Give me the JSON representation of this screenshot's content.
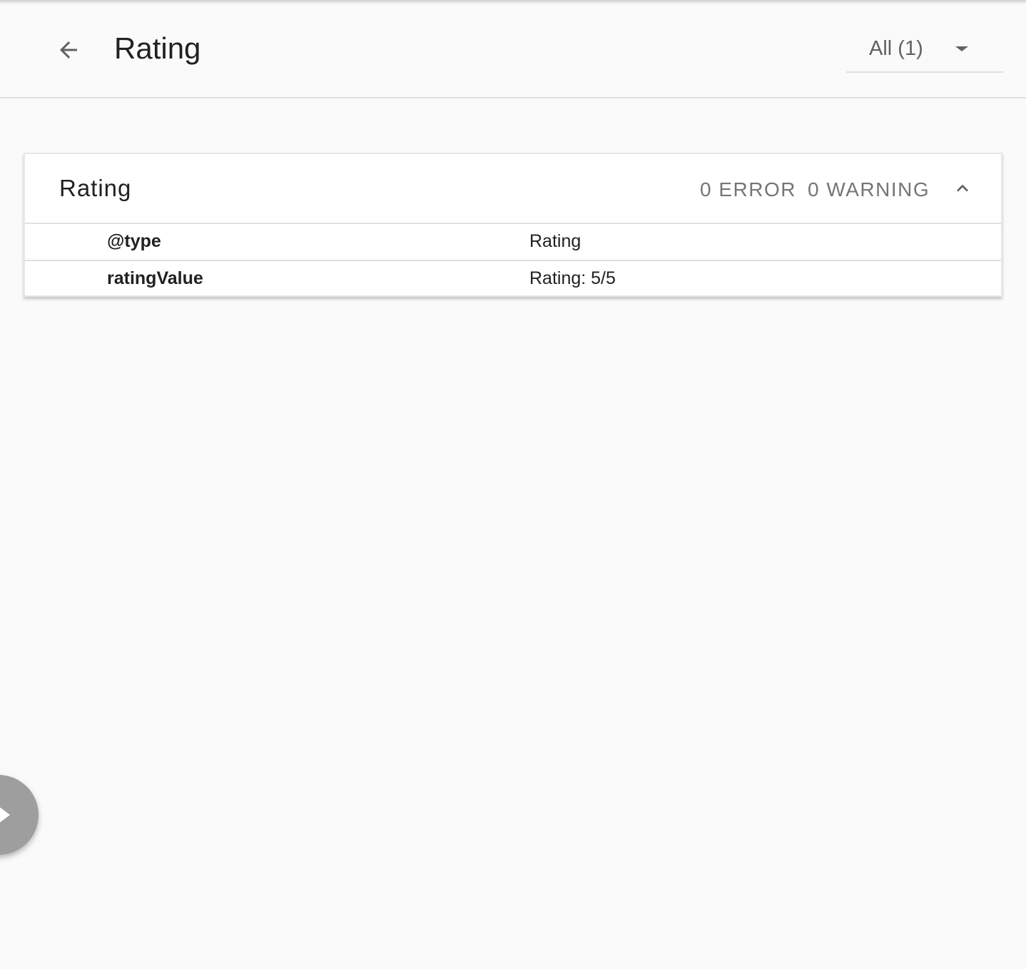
{
  "header": {
    "title": "Rating",
    "back_icon": "arrow-back-icon",
    "filter": {
      "selected": "All (1)",
      "icon": "dropdown-caret-icon"
    }
  },
  "card": {
    "title": "Rating",
    "error_label": "0 ERROR",
    "warning_label": "0 WARNING",
    "collapse_icon": "chevron-up-icon",
    "properties": [
      {
        "key": "@type",
        "value": "Rating"
      },
      {
        "key": "ratingValue",
        "value": "Rating: 5/5"
      }
    ]
  },
  "fab": {
    "icon": "play-arrow-icon"
  },
  "colors": {
    "background": "#fafafa",
    "card": "#ffffff",
    "divider": "#e0e0e0",
    "secondary_text": "#757575",
    "fab": "#9e9e9e"
  }
}
